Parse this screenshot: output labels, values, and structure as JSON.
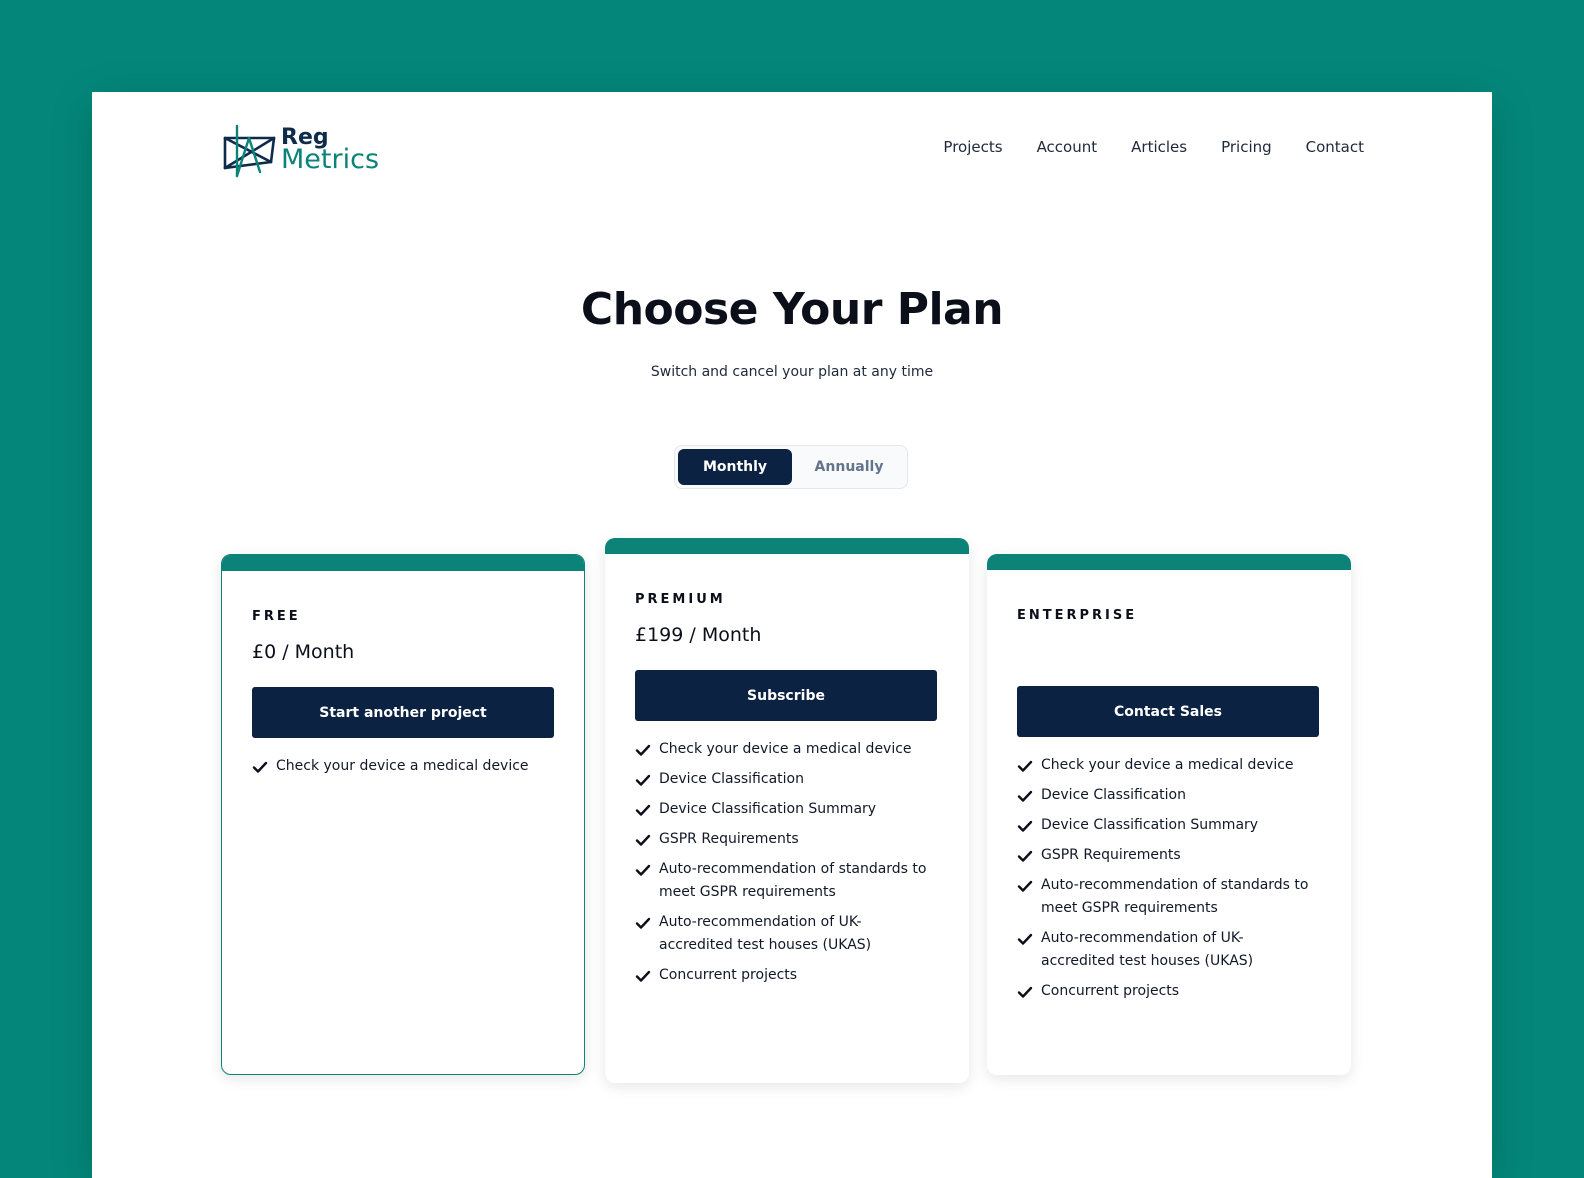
{
  "brand": {
    "line1": "Reg",
    "line2": "Metrics"
  },
  "nav": [
    "Projects",
    "Account",
    "Articles",
    "Pricing",
    "Contact"
  ],
  "hero": {
    "title": "Choose Your Plan",
    "subtitle": "Switch and cancel your plan at any time"
  },
  "billing_toggle": {
    "options": [
      "Monthly",
      "Annually"
    ],
    "selected": "Monthly"
  },
  "colors": {
    "accent": "#0b8378",
    "navy": "#0c2242",
    "background": "#04877a"
  },
  "plans": [
    {
      "tier": "FREE",
      "price": "£0 / Month",
      "cta": "Start another project",
      "features": [
        "Check your device a medical device"
      ]
    },
    {
      "tier": "PREMIUM",
      "price": "£199 / Month",
      "cta": "Subscribe",
      "features": [
        "Check your device a medical device",
        "Device Classification",
        "Device Classification Summary",
        "GSPR Requirements",
        "Auto-recommendation of standards to meet GSPR requirements",
        "Auto-recommendation of UK-accredited test houses (UKAS)",
        "Concurrent projects"
      ]
    },
    {
      "tier": "ENTERPRISE",
      "price": "",
      "cta": "Contact Sales",
      "features": [
        "Check your device a medical device",
        "Device Classification",
        "Device Classification Summary",
        "GSPR Requirements",
        "Auto-recommendation of standards to meet GSPR requirements",
        "Auto-recommendation of UK-accredited test houses (UKAS)",
        "Concurrent projects"
      ]
    }
  ]
}
